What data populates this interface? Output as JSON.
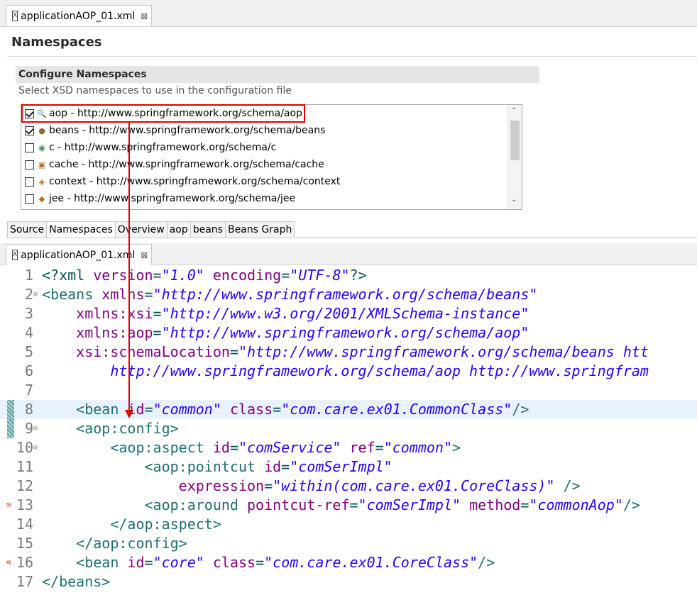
{
  "top_tab": {
    "label": "applicationAOP_01.xml",
    "close": "⊠",
    "icon": "xml-file-icon"
  },
  "namespaces": {
    "title": "Namespaces",
    "section_title": "Configure Namespaces",
    "section_desc": "Select XSD namespaces to use in the configuration file",
    "items": [
      {
        "checked": true,
        "icon": "aop-namespace-icon",
        "label": "aop - http://www.springframework.org/schema/aop"
      },
      {
        "checked": true,
        "icon": "beans-namespace-icon",
        "label": "beans - http://www.springframework.org/schema/beans"
      },
      {
        "checked": false,
        "icon": "c-namespace-icon",
        "label": "c - http://www.springframework.org/schema/c"
      },
      {
        "checked": false,
        "icon": "cache-namespace-icon",
        "label": "cache - http://www.springframework.org/schema/cache"
      },
      {
        "checked": false,
        "icon": "context-namespace-icon",
        "label": "context - http://www.springframework.org/schema/context"
      },
      {
        "checked": false,
        "icon": "jee-namespace-icon",
        "label": "jee - http://www.springframework.org/schema/jee"
      }
    ]
  },
  "sub_tabs": [
    "Source",
    "Namespaces",
    "Overview",
    "aop",
    "beans",
    "Beans Graph"
  ],
  "active_sub_tab": "Namespaces",
  "bottom_tab": {
    "label": "applicationAOP_01.xml",
    "close": "⊠",
    "icon": "xml-file-icon"
  },
  "colors": {
    "highlight": "#e00000",
    "tag": "#207070",
    "attr": "#7f007f",
    "string": "#2a00ff"
  },
  "code": [
    {
      "n": "1",
      "fold": "",
      "parts": [
        [
          "pun",
          "<?xml "
        ],
        [
          "attr",
          "version"
        ],
        [
          "pun",
          "="
        ],
        [
          "str",
          "\"1.0\""
        ],
        [
          "pun",
          " "
        ],
        [
          "attr",
          "encoding"
        ],
        [
          "pun",
          "="
        ],
        [
          "str",
          "\"UTF-8\""
        ],
        [
          "pun",
          "?>"
        ]
      ]
    },
    {
      "n": "2",
      "fold": "⊖",
      "parts": [
        [
          "tag",
          "<beans "
        ],
        [
          "attr",
          "xmlns"
        ],
        [
          "pun",
          "="
        ],
        [
          "str",
          "\"http://www.springframework.org/schema/beans\""
        ]
      ]
    },
    {
      "n": "3",
      "fold": "",
      "parts": [
        [
          "pun",
          "    "
        ],
        [
          "attr",
          "xmlns:xsi"
        ],
        [
          "pun",
          "="
        ],
        [
          "str",
          "\"http://www.w3.org/2001/XMLSchema-instance\""
        ]
      ]
    },
    {
      "n": "4",
      "fold": "",
      "parts": [
        [
          "pun",
          "    "
        ],
        [
          "attr",
          "xmlns:aop"
        ],
        [
          "pun",
          "="
        ],
        [
          "str",
          "\"http://www.springframework.org/schema/aop\""
        ]
      ]
    },
    {
      "n": "5",
      "fold": "",
      "parts": [
        [
          "pun",
          "    "
        ],
        [
          "attr",
          "xsi:schemaLocation"
        ],
        [
          "pun",
          "="
        ],
        [
          "str",
          "\"http://www.springframework.org/schema/beans htt"
        ]
      ]
    },
    {
      "n": "6",
      "fold": "",
      "parts": [
        [
          "str",
          "        http://www.springframework.org/schema/aop http://www.springfram"
        ]
      ]
    },
    {
      "n": "7",
      "fold": "",
      "parts": []
    },
    {
      "n": "8",
      "fold": "",
      "current": true,
      "marker": true,
      "parts": [
        [
          "pun",
          "    "
        ],
        [
          "tag",
          "<bean "
        ],
        [
          "attr",
          "id"
        ],
        [
          "pun",
          "="
        ],
        [
          "str",
          "\"common\""
        ],
        [
          "pun",
          " "
        ],
        [
          "attr",
          "class"
        ],
        [
          "pun",
          "="
        ],
        [
          "str",
          "\"com.care.ex01.CommonClass\""
        ],
        [
          "tag",
          "/>"
        ]
      ]
    },
    {
      "n": "9",
      "fold": "⊖",
      "marker": true,
      "parts": [
        [
          "pun",
          "    "
        ],
        [
          "tag",
          "<aop:config>"
        ]
      ]
    },
    {
      "n": "10",
      "fold": "⊖",
      "parts": [
        [
          "pun",
          "        "
        ],
        [
          "tag",
          "<aop:aspect "
        ],
        [
          "attr",
          "id"
        ],
        [
          "pun",
          "="
        ],
        [
          "str",
          "\"comService\""
        ],
        [
          "pun",
          " "
        ],
        [
          "attr",
          "ref"
        ],
        [
          "pun",
          "="
        ],
        [
          "str",
          "\"common\""
        ],
        [
          "tag",
          ">"
        ]
      ]
    },
    {
      "n": "11",
      "fold": "",
      "parts": [
        [
          "pun",
          "            "
        ],
        [
          "tag",
          "<aop:pointcut "
        ],
        [
          "attr",
          "id"
        ],
        [
          "pun",
          "="
        ],
        [
          "str",
          "\"comSerImpl\""
        ]
      ]
    },
    {
      "n": "12",
      "fold": "",
      "parts": [
        [
          "pun",
          "                "
        ],
        [
          "attr",
          "expression"
        ],
        [
          "pun",
          "="
        ],
        [
          "str",
          "\"within(com.care.ex01.CoreClass)\""
        ],
        [
          "pun",
          " "
        ],
        [
          "tag",
          "/>"
        ]
      ]
    },
    {
      "n": "13",
      "fold": "",
      "bp": "»",
      "parts": [
        [
          "pun",
          "            "
        ],
        [
          "tag",
          "<aop:around "
        ],
        [
          "attr",
          "pointcut-ref"
        ],
        [
          "pun",
          "="
        ],
        [
          "str",
          "\"comSerImpl\""
        ],
        [
          "pun",
          " "
        ],
        [
          "attr",
          "method"
        ],
        [
          "pun",
          "="
        ],
        [
          "str",
          "\"commonAop\""
        ],
        [
          "tag",
          "/>"
        ]
      ]
    },
    {
      "n": "14",
      "fold": "",
      "parts": [
        [
          "pun",
          "        "
        ],
        [
          "tag",
          "</aop:aspect>"
        ]
      ]
    },
    {
      "n": "15",
      "fold": "",
      "parts": [
        [
          "pun",
          "    "
        ],
        [
          "tag",
          "</aop:config>"
        ]
      ]
    },
    {
      "n": "16",
      "fold": "",
      "bp": "«",
      "parts": [
        [
          "pun",
          "    "
        ],
        [
          "tag",
          "<bean "
        ],
        [
          "attr",
          "id"
        ],
        [
          "pun",
          "="
        ],
        [
          "str",
          "\"core\""
        ],
        [
          "pun",
          " "
        ],
        [
          "attr",
          "class"
        ],
        [
          "pun",
          "="
        ],
        [
          "str",
          "\"com.care.ex01.CoreClass\""
        ],
        [
          "tag",
          "/>"
        ]
      ]
    },
    {
      "n": "17",
      "fold": "",
      "parts": [
        [
          "tag",
          "</beans>"
        ]
      ]
    }
  ]
}
